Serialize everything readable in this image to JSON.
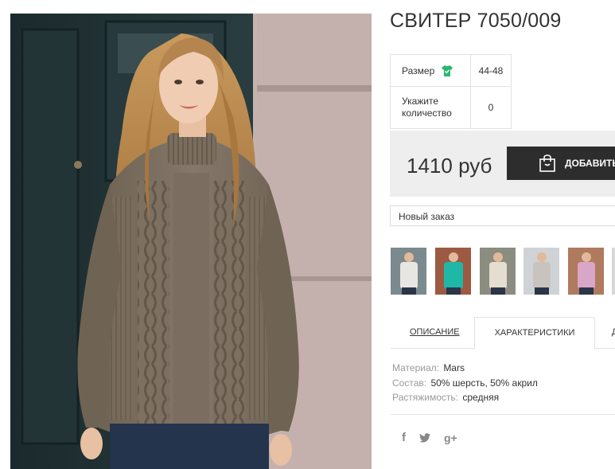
{
  "product": {
    "title": "СВИТЕР 7050/009",
    "image_alt": "woman-in-cable-knit-sweater"
  },
  "options": {
    "size_label": "Размер",
    "size_value": "44-48",
    "qty_label": "Укажите количество",
    "qty_value": "0"
  },
  "purchase": {
    "price": "1410 руб",
    "add_label": "ДОБАВИТЬ",
    "order_select": "Новый заказ"
  },
  "thumbnails": [
    {
      "name": "thumb-white",
      "color": "#e8e6e2"
    },
    {
      "name": "thumb-turquoise",
      "color": "#1fb8a6"
    },
    {
      "name": "thumb-cream",
      "color": "#e4ddd0"
    },
    {
      "name": "thumb-grey",
      "color": "#c8c4bd"
    },
    {
      "name": "thumb-pink",
      "color": "#d9a6c8"
    },
    {
      "name": "thumb-partial",
      "color": "#d8d8d8"
    }
  ],
  "tabs": {
    "description": "ОПИСАНИЕ",
    "characteristics": "ХАРАКТЕРИСТИКИ",
    "more": "Д"
  },
  "specs": {
    "material_label": "Материал:",
    "material_value": "Mars",
    "composition_label": "Состав:",
    "composition_value": "50% шерсть, 50% акрил",
    "stretch_label": "Растяжимость:",
    "stretch_value": "средняя"
  },
  "social": {
    "facebook": "f",
    "twitter": "t",
    "google": "g+"
  },
  "colors": {
    "button": "#2d2d2d",
    "price_bg": "#eeeeee",
    "size_icon": "#2bb673",
    "sweater": "#7a6d5e"
  }
}
